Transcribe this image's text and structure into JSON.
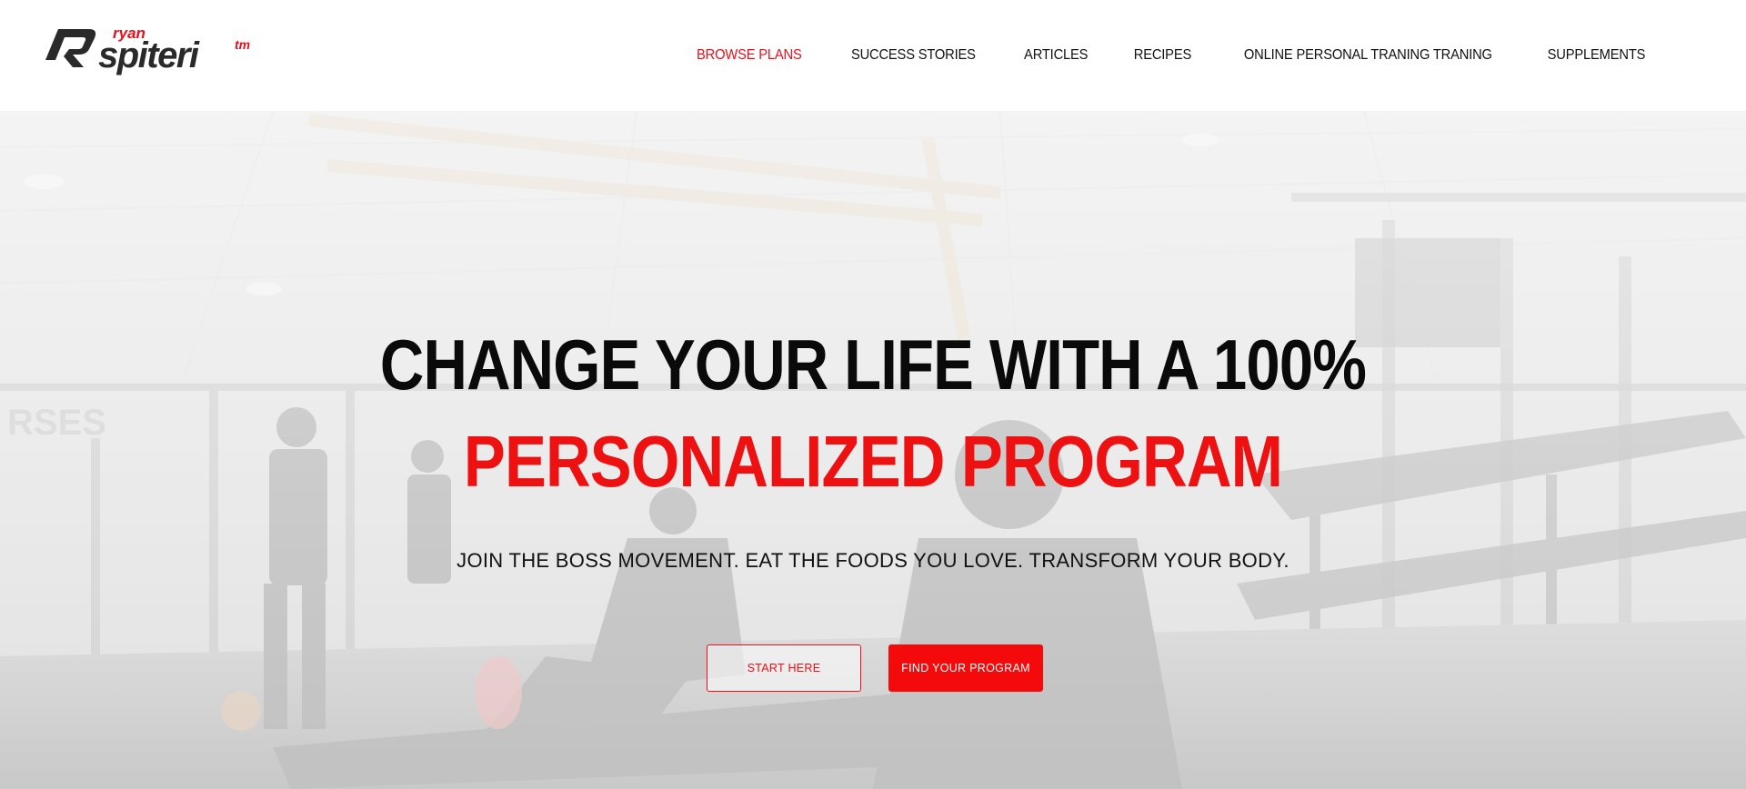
{
  "brand": {
    "logo_top_word": "ryan",
    "logo_main_word": "spiteri",
    "logo_mark": "tm",
    "accent_color": "#e8101a",
    "dark_color": "#2a2a2a"
  },
  "nav": {
    "items": [
      {
        "label": "BROWSE PLANS",
        "active": true
      },
      {
        "label": "SUCCESS STORIES",
        "active": false
      },
      {
        "label": "ARTICLES",
        "active": false
      },
      {
        "label": "RECIPES",
        "active": false
      },
      {
        "label": "ONLINE PERSONAL TRANING TRANING",
        "active": false
      },
      {
        "label": "SUPPLEMENTS",
        "active": false
      }
    ]
  },
  "hero": {
    "headline_line1": "CHANGE YOUR LIFE WITH A 100%",
    "headline_line2": "PERSONALIZED PROGRAM",
    "tagline": "JOIN THE BOSS MOVEMENT. EAT THE FOODS YOU LOVE. TRANSFORM YOUR BODY.",
    "cta_primary_label": "START HERE",
    "cta_secondary_label": "FIND YOUR PROGRAM",
    "background_image": "gym-interior-photo"
  }
}
